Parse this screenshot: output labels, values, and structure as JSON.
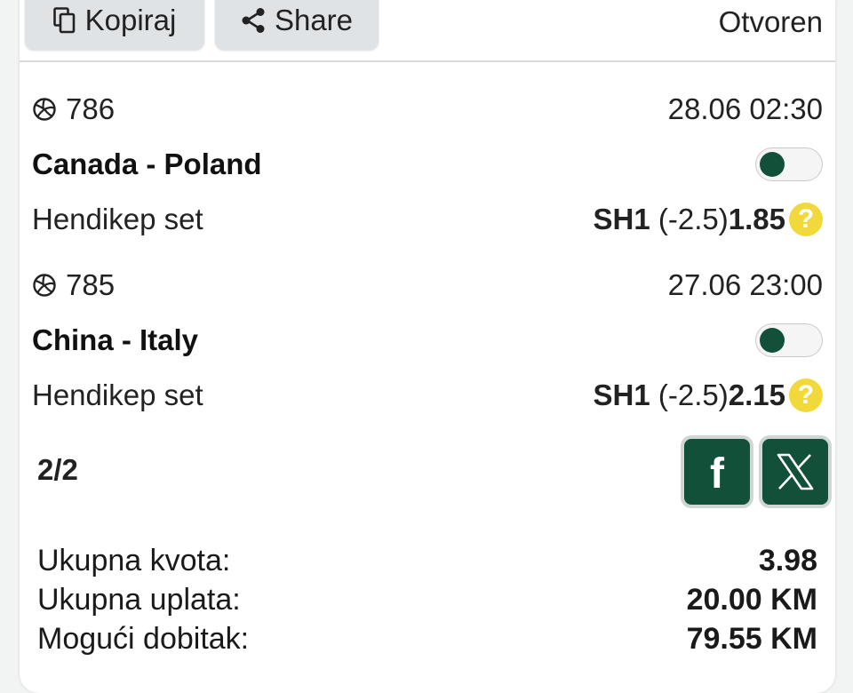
{
  "toolbar": {
    "copy_label": "Kopiraj",
    "share_label": "Share",
    "status": "Otvoren"
  },
  "bets": [
    {
      "code": "786",
      "datetime": "28.06 02:30",
      "match": "Canada - Poland",
      "market": "Hendikep set",
      "pick": "SH1",
      "handicap": "(-2.5)",
      "odds": "1.85",
      "help": "?"
    },
    {
      "code": "785",
      "datetime": "27.06 23:00",
      "match": "China - Italy",
      "market": "Hendikep set",
      "pick": "SH1",
      "handicap": "(-2.5)",
      "odds": "2.15",
      "help": "?"
    }
  ],
  "count": "2/2",
  "social": {
    "facebook_label": "f"
  },
  "summary": {
    "total_odds_label": "Ukupna kvota:",
    "total_odds": "3.98",
    "total_stake_label": "Ukupna uplata:",
    "total_stake": "20.00 KM",
    "possible_win_label": "Mogući dobitak:",
    "possible_win": "79.55 KM"
  },
  "colors": {
    "accent": "#12503a",
    "help": "#f1d93c",
    "button_bg": "#dfe3e5"
  },
  "icons": [
    "copy-icon",
    "share-icon",
    "volleyball-icon",
    "facebook-icon",
    "x-icon"
  ]
}
